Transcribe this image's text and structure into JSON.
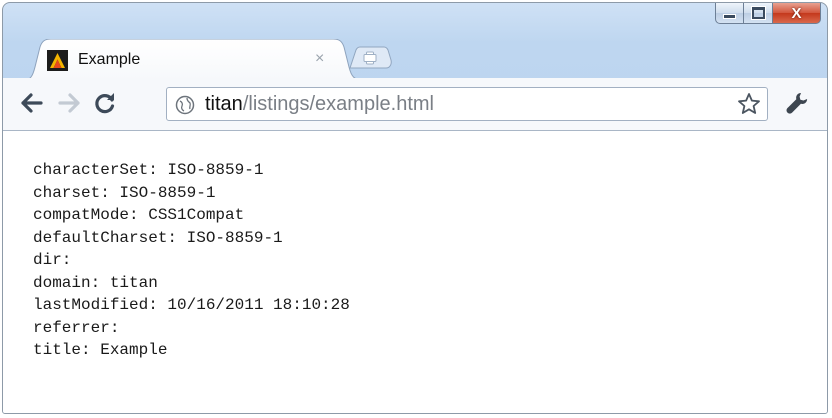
{
  "tab": {
    "title": "Example",
    "close_glyph": "×"
  },
  "window": {
    "close_glyph": "X"
  },
  "omnibox": {
    "host": "titan",
    "path": "/listings/example.html"
  },
  "icons": {
    "favicon": "app-logo-icon",
    "back": "back-arrow-icon",
    "forward": "forward-arrow-icon",
    "reload": "reload-icon",
    "site": "globe-icon",
    "bookmark": "star-icon",
    "menu": "wrench-icon",
    "new_tab": "plus-icon"
  },
  "colors": {
    "chrome_frame": "#bed6f0",
    "close_button": "#c4381c",
    "url_host": "#111111",
    "url_path": "#7a7f86"
  },
  "document_properties": [
    "characterSet: ISO-8859-1",
    "charset: ISO-8859-1",
    "compatMode: CSS1Compat",
    "defaultCharset: ISO-8859-1",
    "dir:",
    "domain: titan",
    "lastModified: 10/16/2011 18:10:28",
    "referrer:",
    "title: Example"
  ]
}
